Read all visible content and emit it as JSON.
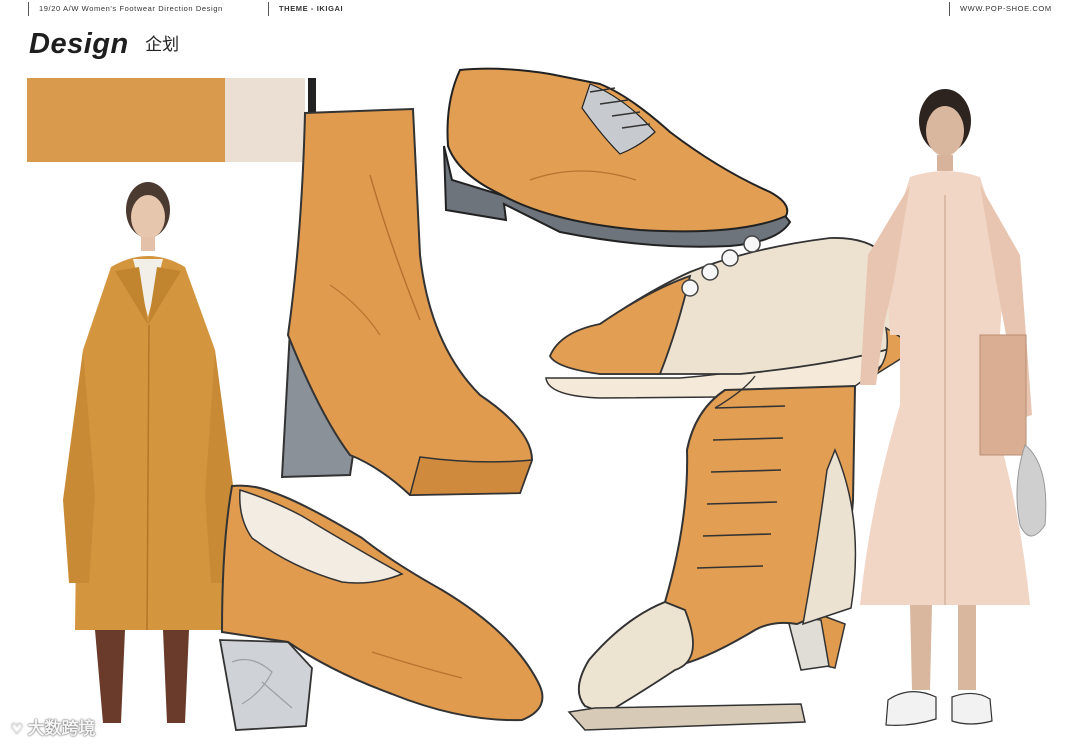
{
  "header": {
    "season_line": "19/20 A/W Women's Footwear Direction Design",
    "theme": "THEME - IKIGAI",
    "website": "WWW.POP-SHOE.COM"
  },
  "title": {
    "main": "Design",
    "sub": "企划"
  },
  "palette": {
    "accent": "#D99A4E",
    "light": "#EADFD2",
    "dark_bar": "#222222"
  },
  "watermark": {
    "text": "大数跨境",
    "logo_glyph": "♡"
  }
}
